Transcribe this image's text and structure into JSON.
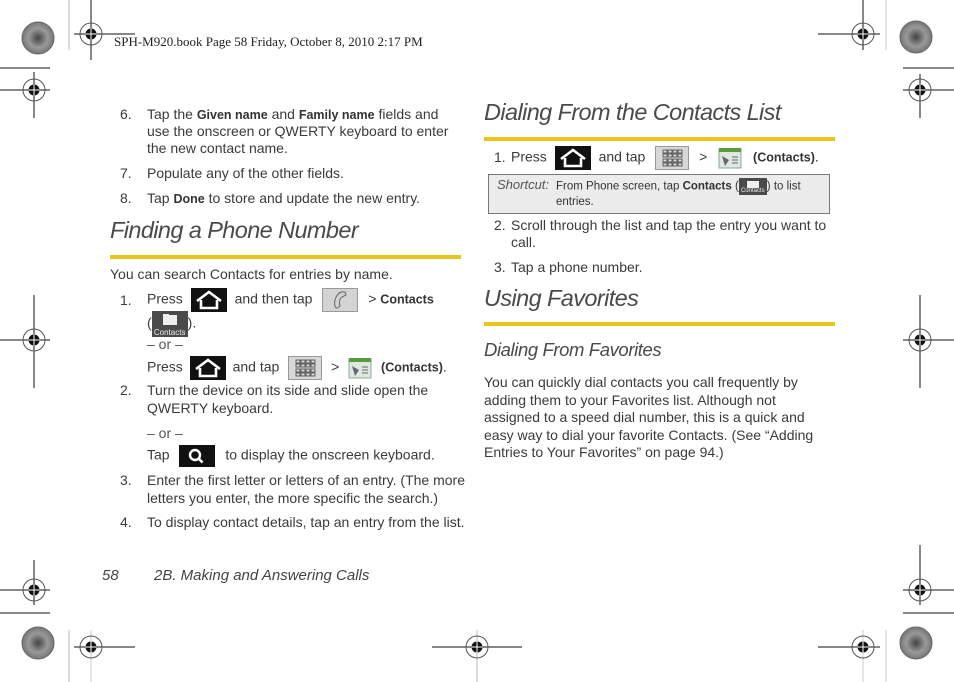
{
  "print_header": "SPH-M920.book  Page 58  Friday, October 8, 2010  2:17 PM",
  "left_column": {
    "steps_top": [
      {
        "num": "6.",
        "lines": [
          {
            "pre": "Tap the ",
            "b1": "Given name",
            "mid": " and ",
            "b2": "Family name",
            "post": " fields and"
          },
          "use the onscreen or QWERTY keyboard to enter",
          "the new contact name."
        ]
      },
      {
        "num": "7.",
        "text": "Populate any of the other fields."
      },
      {
        "num": "8.",
        "pre": "Tap ",
        "bold": "Done",
        "post": " to store and update the new entry."
      }
    ],
    "section_title": "Finding a Phone Number",
    "intro": "You can search Contacts for entries by name.",
    "step1": {
      "num": "1.",
      "press": "Press",
      "and_then_tap": "and then tap",
      "gt": ">",
      "contacts_bold": "Contacts",
      "open_paren": "(",
      "close_paren": ").",
      "or": "– or –",
      "press2": "Press",
      "and_tap": "and tap",
      "gt2": ">",
      "contacts_paren": "(Contacts)",
      "period": "."
    },
    "step2": {
      "num": "2.",
      "line1": "Turn the device on its side and slide open the",
      "line2": "QWERTY keyboard.",
      "or": "– or –",
      "tap": "Tap",
      "after_icon": "to display the onscreen keyboard."
    },
    "step3": {
      "num": "3.",
      "line1": "Enter the first letter or letters of an entry. (The more",
      "line2": "letters you enter, the more specific the search.)"
    },
    "step4": {
      "num": "4.",
      "text": "To display contact details, tap an entry from the list."
    }
  },
  "right_column": {
    "section1_title": "Dialing From the Contacts List",
    "step1": {
      "num": "1.",
      "press": "Press",
      "and_tap": "and tap",
      "gt": ">",
      "contacts_paren": "(Contacts)",
      "period": "."
    },
    "shortcut": {
      "label": "Shortcut:",
      "pre": "From Phone screen, tap ",
      "bold": "Contacts",
      "open": " (",
      "close": ") to list",
      "line2": "entries."
    },
    "step2": {
      "num": "2.",
      "line1": "Scroll through the list and tap the entry you want to",
      "line2": "call."
    },
    "step3": {
      "num": "3.",
      "text": "Tap a phone number."
    },
    "section2_title": "Using Favorites",
    "subsection_title": "Dialing From Favorites",
    "paragraph": [
      "You can quickly dial contacts you call frequently by",
      "adding them to your Favorites list. Although not",
      "assigned to a speed dial number, this is a quick and",
      "easy way to dial your favorite Contacts. (See “Adding",
      "Entries to Your Favorites” on page 94.)"
    ]
  },
  "icons": {
    "contacts_label": "Contacts",
    "home": "home-key-icon",
    "phone": "phone-app-icon",
    "grid": "applications-grid-icon",
    "search": "search-key-icon",
    "contacts": "contacts-icon"
  },
  "footer": {
    "page_number": "58",
    "chapter": "2B. Making and Answering Calls"
  },
  "colors": {
    "accent_rule": "#e8c618",
    "heading": "#4a4a4a",
    "shortcut_bg": "#ececec"
  }
}
